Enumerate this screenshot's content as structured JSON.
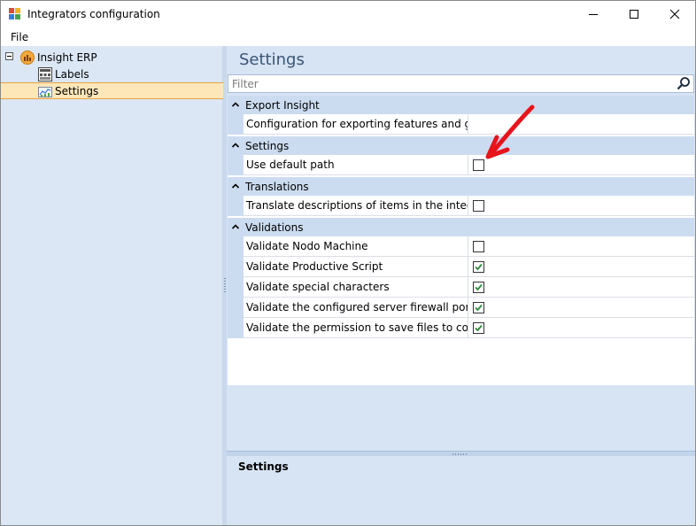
{
  "window": {
    "title": "Integrators configuration",
    "controls": [
      "minimize",
      "maximize",
      "close"
    ]
  },
  "menu": {
    "items": [
      "File"
    ]
  },
  "tree": {
    "root": {
      "label": "Insight ERP",
      "icon": "erp-globe-icon",
      "expanded": true
    },
    "children": [
      {
        "label": "Labels",
        "icon": "labels-icon",
        "selected": false
      },
      {
        "label": "Settings",
        "icon": "chart-icon",
        "selected": true
      }
    ]
  },
  "settings": {
    "title": "Settings",
    "filter_placeholder": "Filter",
    "categories": [
      {
        "label": "Export Insight",
        "properties": [
          {
            "name": "Configuration for exporting features and groups...",
            "type": "text",
            "value": ""
          }
        ]
      },
      {
        "label": "Settings",
        "properties": [
          {
            "name": "Use default path",
            "type": "checkbox",
            "checked": false
          }
        ]
      },
      {
        "label": "Translations",
        "properties": [
          {
            "name": "Translate descriptions of items in the integration",
            "type": "checkbox",
            "checked": false
          }
        ]
      },
      {
        "label": "Validations",
        "properties": [
          {
            "name": "Validate Nodo Machine",
            "type": "checkbox",
            "checked": false
          },
          {
            "name": "Validate Productive Script",
            "type": "checkbox",
            "checked": true
          },
          {
            "name": "Validate special characters",
            "type": "checkbox",
            "checked": true
          },
          {
            "name": "Validate the configured server firewall port is op...",
            "type": "checkbox",
            "checked": true
          },
          {
            "name": "Validate the permission to save files to configure...",
            "type": "checkbox",
            "checked": true
          }
        ]
      }
    ],
    "description_title": "Settings"
  },
  "colors": {
    "accent_check": "#2e8b3a",
    "title_blue": "#3c5473",
    "annotation_red": "#e8141c"
  }
}
